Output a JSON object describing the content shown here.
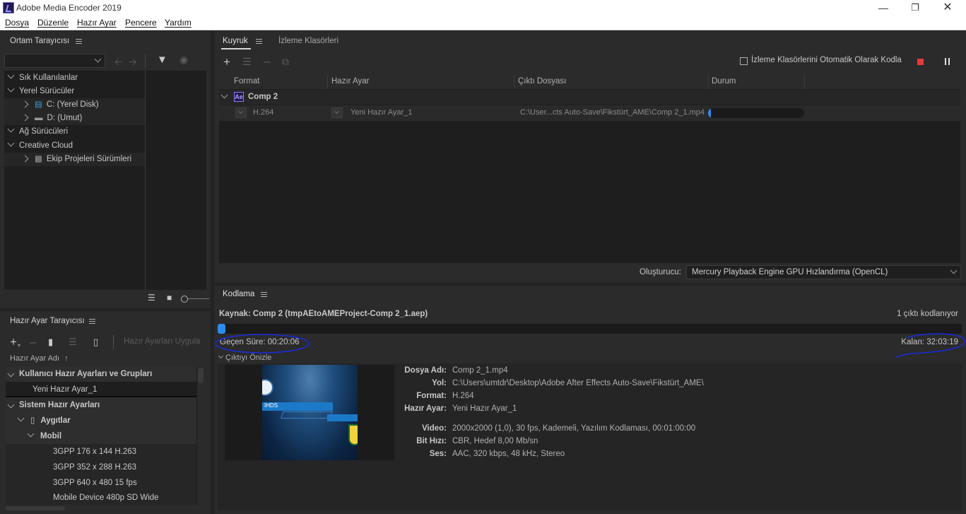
{
  "window": {
    "title": "Adobe Media Encoder 2019"
  },
  "menu": [
    "Dosya",
    "Düzenle",
    "Hazır Ayar",
    "Pencere",
    "Yardım"
  ],
  "media_browser": {
    "title": "Ortam Tarayıcısı",
    "tree": {
      "favorites": "Sık Kullanılanlar",
      "local_drives": "Yerel Sürücüler",
      "drive_c": "C: (Yerel Disk)",
      "drive_d": "D: (Umut)",
      "network_drives": "Ağ Sürücüleri",
      "creative_cloud": "Creative Cloud",
      "team_projects": "Ekip Projeleri Sürümleri"
    }
  },
  "preset_browser": {
    "title": "Hazır Ayar Tarayıcısı",
    "apply_placeholder": "Hazır Ayarları Uygula",
    "column_header": "Hazır Ayar Adı",
    "user_group": "Kullanıcı Hazır Ayarları ve Grupları",
    "user_preset": "Yeni Hazır Ayar_1",
    "system_group": "Sistem Hazır Ayarları",
    "devices": "Aygıtlar",
    "mobile": "Mobil",
    "items": [
      "3GPP 176 x 144 H.263",
      "3GPP 352 x 288 H.263",
      "3GPP 640 x 480 15 fps",
      "Mobile Device 480p SD Wide"
    ]
  },
  "queue": {
    "tab_queue": "Kuyruk",
    "tab_watch": "İzleme Klasörleri",
    "auto_encode_label": "İzleme Klasörlerini Otomatik Olarak Kodla",
    "columns": {
      "format": "Format",
      "preset": "Hazır Ayar",
      "output": "Çıktı Dosyası",
      "status": "Durum"
    },
    "item": {
      "badge": "Ae",
      "name": "Comp 2",
      "format": "H.264",
      "preset": "Yeni Hazır Ayar_1",
      "output": "C:\\User...cts Auto-Save\\Fikstürt_AME\\Comp 2_1.mp4",
      "progress": 0.01
    },
    "renderer_label": "Oluşturucu:",
    "renderer_value": "Mercury Playback Engine GPU Hızlandırma (OpenCL)"
  },
  "encoding": {
    "title": "Kodlama",
    "source": "Kaynak: Comp 2 (tmpAEtoAMEProject-Comp 2_1.aep)",
    "outputs_count": "1 çıktı kodlanıyor",
    "progress": 0.01,
    "elapsed": "Geçen Süre: 00:20:06",
    "remaining": "Kalan: 32:03:19",
    "preview_title": "Çıktıyı Önizle",
    "preview_thumb_text": "IHDS",
    "info": {
      "file_name_k": "Dosya Adı:",
      "file_name_v": "Comp 2_1.mp4",
      "path_k": "Yol:",
      "path_v": "C:\\Users\\umtdr\\Desktop\\Adobe After Effects Auto-Save\\Fikstürt_AME\\",
      "format_k": "Format:",
      "format_v": "H.264",
      "preset_k": "Hazır Ayar:",
      "preset_v": "Yeni Hazır Ayar_1",
      "video_k": "Video:",
      "video_v": "2000x2000 (1,0), 30 fps, Kademeli, Yazılım Kodlaması, 00:01:00:00",
      "bitrate_k": "Bit Hızı:",
      "bitrate_v": "CBR, Hedef 8,00 Mb/sn",
      "audio_k": "Ses:",
      "audio_v": "AAC, 320 kbps, 48 kHz, Stereo"
    }
  },
  "colors": {
    "accent": "#2d8ceb",
    "annotation": "#1c2bd6",
    "stop": "#e53a3a"
  }
}
